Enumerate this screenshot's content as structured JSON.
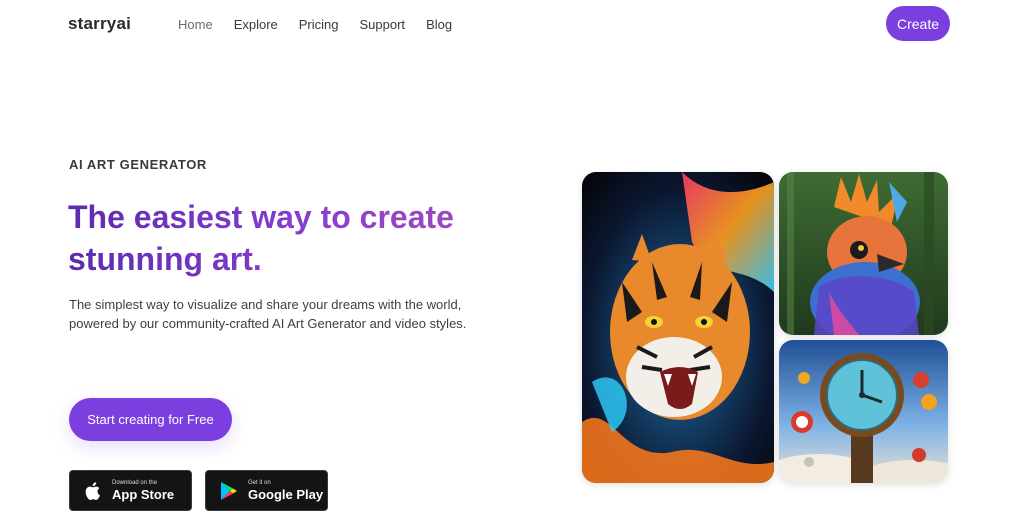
{
  "header": {
    "logo": "starryai",
    "nav": [
      {
        "label": "Home",
        "active": true
      },
      {
        "label": "Explore",
        "active": false
      },
      {
        "label": "Pricing",
        "active": false
      },
      {
        "label": "Support",
        "active": false
      },
      {
        "label": "Blog",
        "active": false
      }
    ],
    "create_label": "Create"
  },
  "hero": {
    "eyebrow": "AI ART GENERATOR",
    "headline": "The easiest way to create stunning art.",
    "subtext": "The simplest way to visualize and share your dreams with the world, powered by our community-crafted AI Art Generator and video styles.",
    "cta_label": "Start creating for Free"
  },
  "stores": {
    "apple": {
      "small": "Download on the",
      "big": "App Store",
      "icon": "apple-icon"
    },
    "google": {
      "small": "Get it on",
      "big": "Google Play",
      "icon": "google-play-icon"
    }
  },
  "gallery": [
    {
      "name": "tiger-artwork",
      "subject": "tiger"
    },
    {
      "name": "bird-artwork",
      "subject": "bird"
    },
    {
      "name": "clock-artwork",
      "subject": "clock"
    }
  ],
  "colors": {
    "accent": "#7b3fe0",
    "headline_start": "#5b2bb0",
    "headline_end": "#a24ab8"
  }
}
